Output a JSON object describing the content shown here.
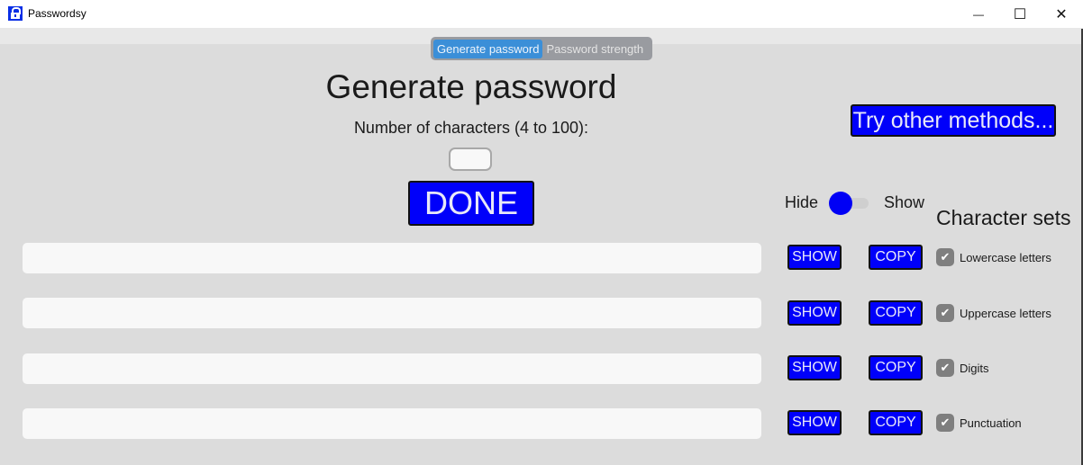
{
  "window": {
    "title": "Passwordsy",
    "minimize_glyph": "—",
    "maximize_glyph": "☐",
    "close_glyph": "✕"
  },
  "tabs": [
    {
      "label": "Generate password",
      "active": true
    },
    {
      "label": "Password strength",
      "active": false
    }
  ],
  "main": {
    "heading": "Generate password",
    "length_label": "Number of characters (4 to 100):",
    "length_value": "",
    "done_label": "DONE",
    "try_other_label": "Try other methods...",
    "toggle": {
      "hide_label": "Hide",
      "show_label": "Show",
      "state": "hide"
    }
  },
  "passwords": [
    {
      "value": "",
      "show_label": "SHOW",
      "copy_label": "COPY"
    },
    {
      "value": "",
      "show_label": "SHOW",
      "copy_label": "COPY"
    },
    {
      "value": "",
      "show_label": "SHOW",
      "copy_label": "COPY"
    },
    {
      "value": "",
      "show_label": "SHOW",
      "copy_label": "COPY"
    }
  ],
  "character_sets": {
    "title": "Character sets",
    "check_glyph": "✔",
    "items": [
      {
        "label": "Lowercase letters",
        "checked": true
      },
      {
        "label": "Uppercase letters",
        "checked": true
      },
      {
        "label": "Digits",
        "checked": true
      },
      {
        "label": "Punctuation",
        "checked": true
      }
    ]
  },
  "colors": {
    "button": "#0000fa",
    "tab_active": "#3b8fd8",
    "checkbox": "#7f7f7f"
  }
}
